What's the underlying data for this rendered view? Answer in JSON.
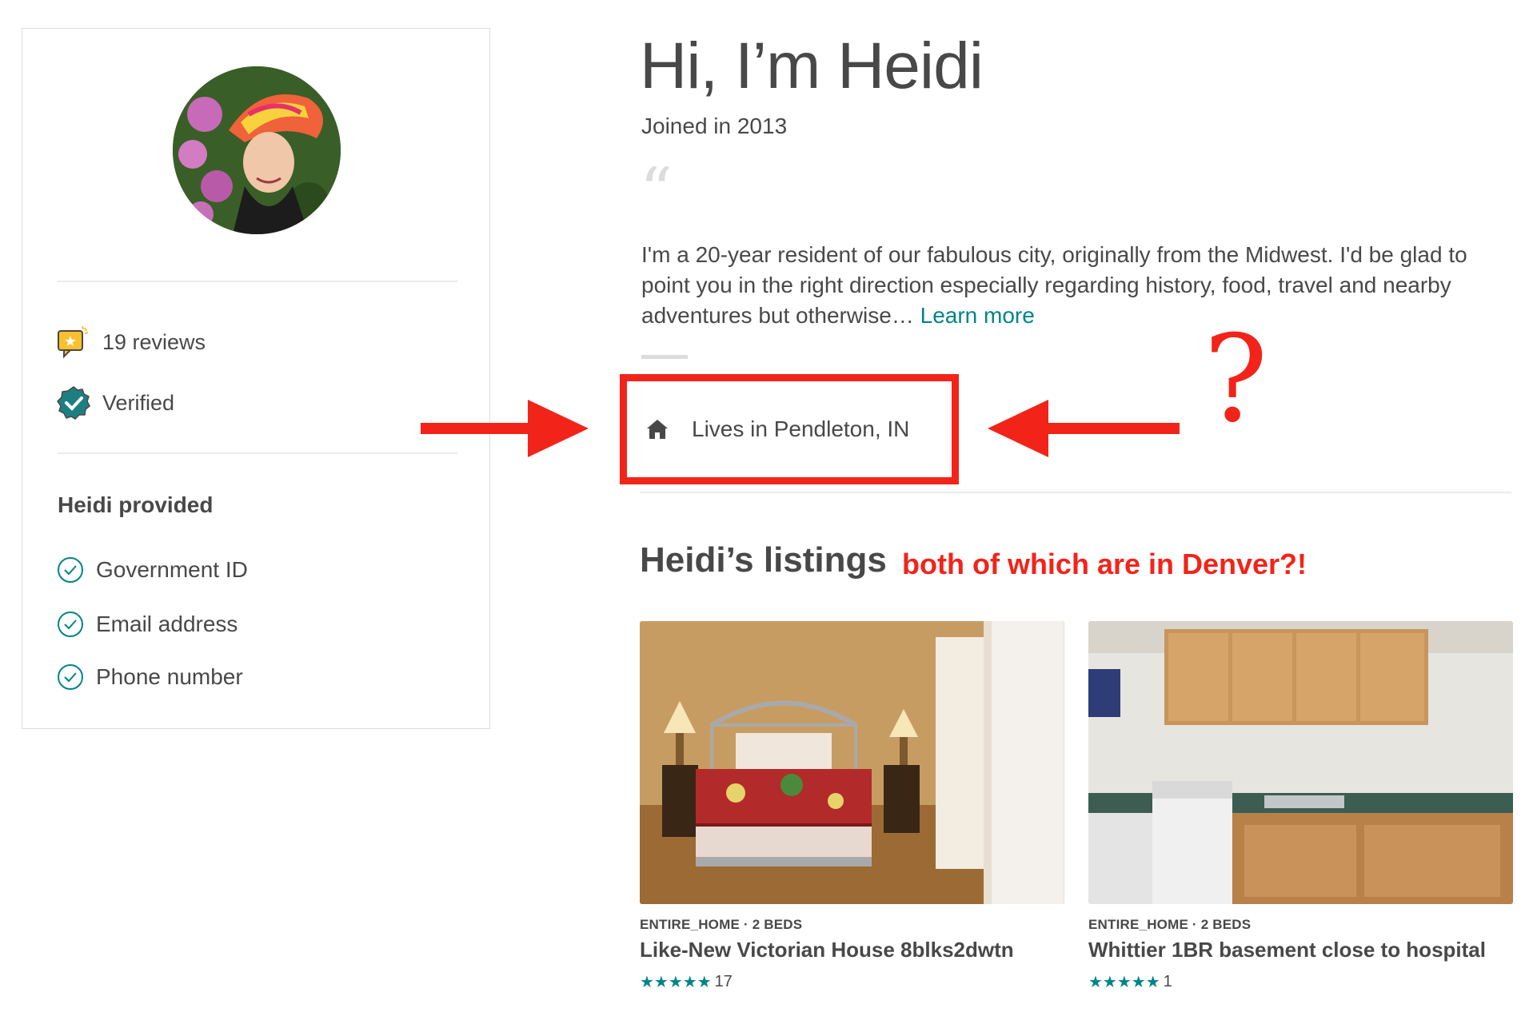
{
  "profile": {
    "name": "Heidi",
    "heading": "Hi, I’m Heidi",
    "joined": "Joined in 2013",
    "about": "I'm a 20-year resident of our fabulous city, originally from the Midwest. I'd be glad to point you in the right direction especially regarding history, food, travel and nearby adventures but otherwise…",
    "learn_more": "Learn more",
    "lives_in": "Lives in Pendleton, IN"
  },
  "sidebar": {
    "reviews": "19 reviews",
    "verified": "Verified",
    "provided_title": "Heidi provided",
    "provided_items": [
      "Government ID",
      "Email address",
      "Phone number"
    ]
  },
  "listings": {
    "title": "Heidi’s listings",
    "items": [
      {
        "type": "ENTIRE_HOME · 2 BEDS",
        "name": "Like-New Victorian House 8blks2dwtn",
        "stars": "★★★★★",
        "rating": 4.5,
        "review_count": "17"
      },
      {
        "type": "ENTIRE_HOME · 2 BEDS",
        "name": "Whittier 1BR basement close to hospital",
        "stars": "★★★★★",
        "rating": 5,
        "review_count": "1"
      }
    ]
  },
  "annotations": {
    "note": "both of which are in Denver?!",
    "question_mark": "?",
    "color": "#f2241a"
  },
  "colors": {
    "accent": "#008489",
    "text": "#484848",
    "divider": "#ebebeb"
  },
  "icons": [
    "avatar-photo",
    "review-badge-icon",
    "verified-badge-icon",
    "check-circle-icon",
    "quote-icon",
    "home-icon",
    "star-icon",
    "arrow-right-icon",
    "arrow-left-icon"
  ]
}
